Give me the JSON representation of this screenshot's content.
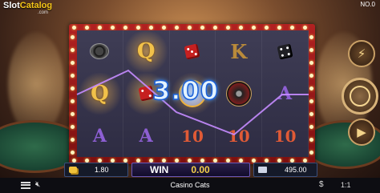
{
  "branding": {
    "logo_main": "Slot",
    "logo_accent": "Catalog",
    "logo_sub": ".com"
  },
  "round_label": "NO.0",
  "reels": [
    [
      "chips",
      "Q",
      "A"
    ],
    [
      "Q",
      "dice-red",
      "A"
    ],
    [
      "dice-red",
      "cat-wild",
      "10"
    ],
    [
      "K",
      "roulette",
      "10"
    ],
    [
      "dice-black",
      "A",
      "10"
    ]
  ],
  "win_overlay": "3.00",
  "bet": {
    "value": "1.80"
  },
  "win": {
    "label": "WIN",
    "value": "0.00"
  },
  "balance": {
    "value": "495.00"
  },
  "footer": {
    "game_title": "Casino Cats",
    "speed": "1:1",
    "currency_symbol": "$"
  },
  "icons": {
    "side_top": "lightning-icon",
    "spin": "spin-icon",
    "bet": "coins-icon",
    "wallet": "wallet-icon",
    "menu": "menu-icon",
    "sound": "speaker-muted-icon"
  },
  "colors": {
    "frame": "#b22121",
    "win_text": "#e3f3ff",
    "payline": "#c58cff",
    "accent": "#f6d14a"
  }
}
